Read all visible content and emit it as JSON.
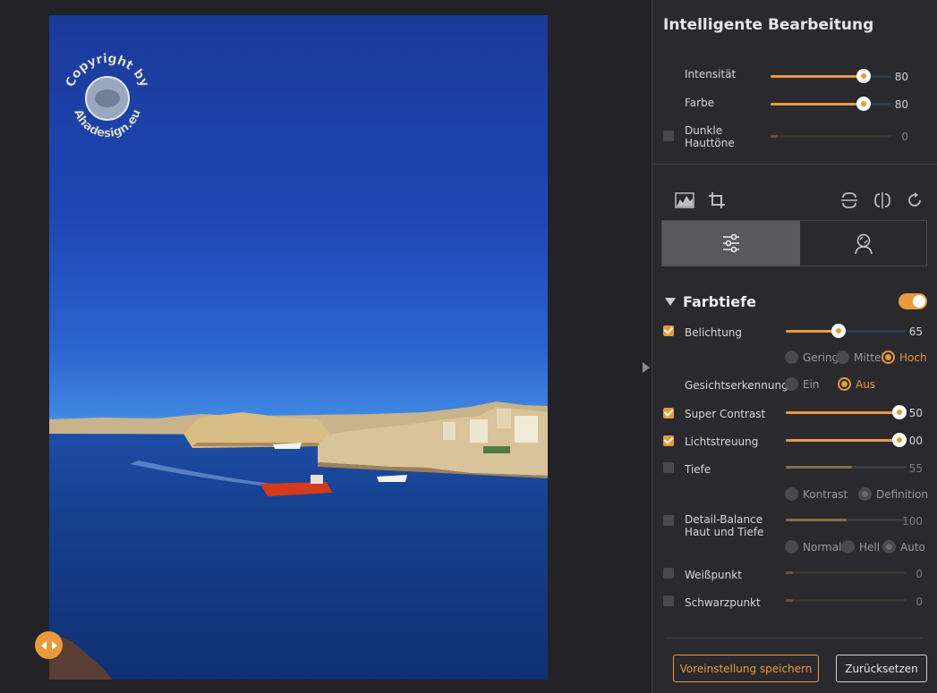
{
  "panel": {
    "title": "Intelligente Bearbeitung",
    "top_sliders": [
      {
        "label": "Intensität",
        "value": "80",
        "level": 0.8
      },
      {
        "label": "Farbe",
        "value": "80",
        "level": 0.8
      }
    ],
    "dark_skin": {
      "label_line1": "Dunkle",
      "label_line2": "Hauttöne",
      "value": "0",
      "level": 0.0,
      "checked": false
    }
  },
  "toolbar": {
    "icons": [
      "histogram-icon",
      "crop-icon",
      "flip-vertical-icon",
      "flip-horizontal-icon",
      "rotate-icon"
    ]
  },
  "tabs": [
    {
      "icon": "sliders-icon",
      "active": true
    },
    {
      "icon": "face-retouch-icon",
      "active": false
    }
  ],
  "section": {
    "title": "Farbtiefe",
    "enabled": true,
    "belichtung": {
      "label": "Belichtung",
      "value": "65",
      "level": 0.44,
      "checked": true,
      "options": [
        "Gering",
        "Mittel",
        "Hoch"
      ],
      "selected": "Hoch"
    },
    "face": {
      "label": "Gesichtserkennung",
      "options": [
        "Ein",
        "Aus"
      ],
      "selected": "Aus"
    },
    "super_contrast": {
      "label": "Super Contrast",
      "value": "50",
      "level": 0.94,
      "checked": true
    },
    "lichtstreuung": {
      "label": "Lichtstreuung",
      "value": "00",
      "level": 0.94,
      "checked": true
    },
    "tiefe": {
      "label": "Tiefe",
      "value": "55",
      "level": 0.55,
      "checked": false,
      "options": [
        "Kontrast",
        "Definition"
      ],
      "selected": "Definition"
    },
    "detail": {
      "label_line1": "Detail-Balance",
      "label_line2": "Haut und Tiefe",
      "value": "100",
      "level": 0.5,
      "checked": false,
      "options": [
        "Normal",
        "Hell",
        "Auto"
      ],
      "selected": "Auto"
    },
    "weisspunkt": {
      "label": "Weißpunkt",
      "value": "0",
      "level": 0.06,
      "checked": false
    },
    "schwarzpunkt": {
      "label": "Schwarzpunkt",
      "value": "0",
      "level": 0.06,
      "checked": false
    }
  },
  "buttons": {
    "save": "Voreinstellung speichern",
    "reset": "Zurücksetzen"
  },
  "watermark": {
    "text_top": "Copyright by",
    "text_bottom": "Ahadesign.eu"
  },
  "colors": {
    "accent": "#e89a3c",
    "panel_bg": "#2a292e",
    "canvas_bg": "#232226"
  }
}
